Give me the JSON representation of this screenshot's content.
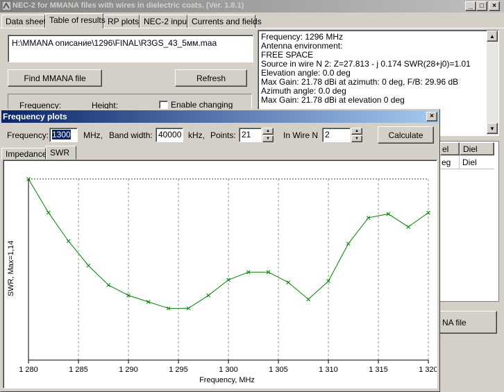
{
  "main_window": {
    "title": "NEC-2 for MMANA files with wires in dielectric coats. (Ver. 1.8.1)",
    "controls": {
      "minimize": "_",
      "maximize": "□",
      "close": "×"
    }
  },
  "tabs": [
    {
      "label": "Data sheet",
      "active": false
    },
    {
      "label": "Table of results",
      "active": true
    },
    {
      "label": "RP plots",
      "active": false
    },
    {
      "label": "NEC-2 input",
      "active": false
    },
    {
      "label": "Currents and fields",
      "active": false
    }
  ],
  "file_path": "H:\\MMANA описание\\1296\\FINAL\\R3GS_43_5мм.maa",
  "buttons": {
    "find_file": "Find MMANA file",
    "refresh": "Refresh",
    "find_file_partial": "NA file",
    "calculate": "Calculate"
  },
  "options": {
    "frequency_label": "Frequency:",
    "height_label": "Height:",
    "enable_changing_label": "Enable changing"
  },
  "results_text": [
    "Frequency:   1296  MHz",
    "Antenna environment:",
    "     FREE SPACE",
    "Source in wire N 2:      Z=27.813 - j 0.174   SWR(28+j0)=1.01",
    "Elevation angle: 0.0 deg",
    "Max Gain: 21.78 dBi  at azimuth: 0 deg,  F/B: 29.96 dB",
    "Azimuth angle: 0.0 deg",
    "Max Gain: 21.78 dBi at elevation  0 deg"
  ],
  "wire_table": {
    "headers": [
      "el",
      "Diel"
    ],
    "row": [
      "eg",
      "Diel"
    ]
  },
  "freq_plots": {
    "title": "Frequency plots",
    "frequency_label": "Frequency:",
    "frequency_value": "1300",
    "frequency_unit": "MHz,",
    "bandwidth_label": "Band width:",
    "bandwidth_value": "40000",
    "bandwidth_unit": "kHz,",
    "points_label": "Points:",
    "points_value": "21",
    "wire_label": "In Wire N",
    "wire_value": "2",
    "subtabs": [
      {
        "label": "Impedance",
        "active": false
      },
      {
        "label": "SWR",
        "active": true
      }
    ]
  },
  "chart_data": {
    "type": "line",
    "title": "",
    "xlabel": "Frequency, MHz",
    "ylabel": "SWR,  Max=1,14",
    "xlim": [
      1280,
      1320
    ],
    "ylim": [
      1.0,
      1.14
    ],
    "x_ticks": [
      1280,
      1285,
      1290,
      1295,
      1300,
      1305,
      1310,
      1315,
      1320
    ],
    "x_tick_labels": [
      "1 280",
      "1 285",
      "1 290",
      "1 295",
      "1 300",
      "1 305",
      "1 310",
      "1 315",
      "1 320"
    ],
    "grid": "vertical dashed",
    "line_color": "#008000",
    "series": [
      {
        "x": [
          1280,
          1282,
          1284,
          1286,
          1288,
          1290,
          1292,
          1294,
          1296,
          1298,
          1300,
          1302,
          1304,
          1306,
          1308,
          1310,
          1312,
          1314,
          1316,
          1318,
          1320
        ],
        "values": [
          1.14,
          1.114,
          1.092,
          1.073,
          1.058,
          1.05,
          1.045,
          1.04,
          1.04,
          1.05,
          1.062,
          1.068,
          1.068,
          1.06,
          1.047,
          1.061,
          1.09,
          1.11,
          1.113,
          1.103,
          1.114
        ]
      }
    ]
  }
}
